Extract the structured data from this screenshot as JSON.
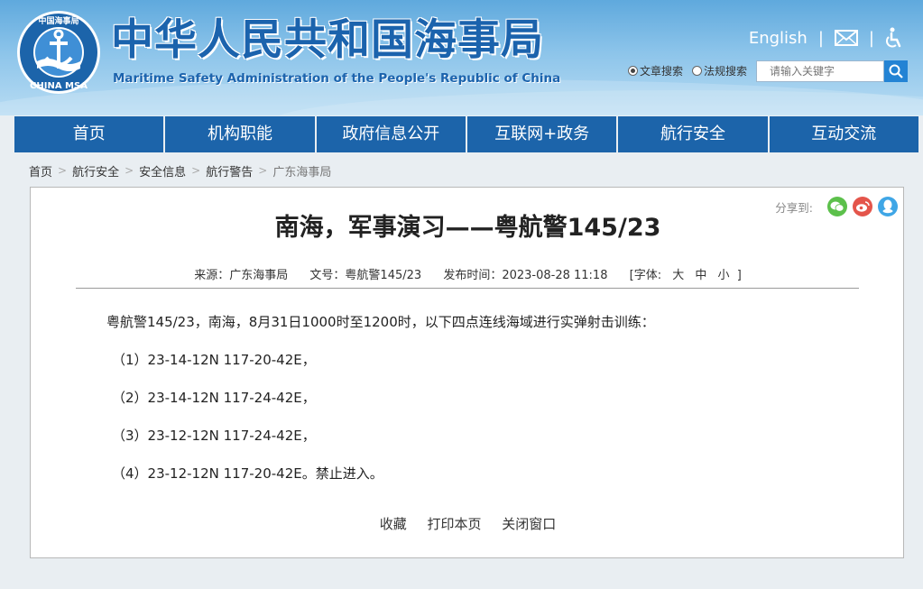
{
  "header": {
    "logo_top_text": "中国海事局",
    "logo_bottom_text": "CHINA MSA",
    "site_title": "中华人民共和国海事局",
    "site_subtitle": "Maritime Safety Administration of the People's Republic of China",
    "english_link": "English",
    "separator": "|",
    "search": {
      "option_article": "文章搜索",
      "option_regulation": "法规搜索",
      "selected": "文章搜索",
      "placeholder": "请输入关键字"
    }
  },
  "nav": {
    "items": [
      "首页",
      "机构职能",
      "政府信息公开",
      "互联网+政务",
      "航行安全",
      "互动交流"
    ]
  },
  "breadcrumb": {
    "items": [
      "首页",
      "航行安全",
      "安全信息",
      "航行警告",
      "广东海事局"
    ],
    "separator": ">"
  },
  "article": {
    "share_label": "分享到:",
    "title": "南海，军事演习——粤航警145/23",
    "meta": {
      "source_label": "来源：",
      "source": "广东海事局",
      "doc_label": "文号：",
      "doc_no": "粤航警145/23",
      "time_label": "发布时间：",
      "time": "2023-08-28 11:18",
      "font_label": "[字体:",
      "font_large": "大",
      "font_medium": "中",
      "font_small": "小",
      "font_end": "]"
    },
    "body": [
      "粤航警145/23，南海，8月31日1000时至1200时，以下四点连线海域进行实弹射击训练：",
      "（1）23-14-12N 117-20-42E，",
      "（2）23-14-12N 117-24-42E，",
      "（3）23-12-12N 117-24-42E，",
      "（4）23-12-12N 117-20-42E。禁止进入。"
    ],
    "actions": [
      "收藏",
      "打印本页",
      "关闭窗口"
    ]
  },
  "colors": {
    "brand_blue": "#1c64aa",
    "title_blue": "#1b63ad",
    "wechat_green": "#5cc04b",
    "weibo_red": "#e4554b",
    "qq_blue": "#3fa6e6"
  }
}
